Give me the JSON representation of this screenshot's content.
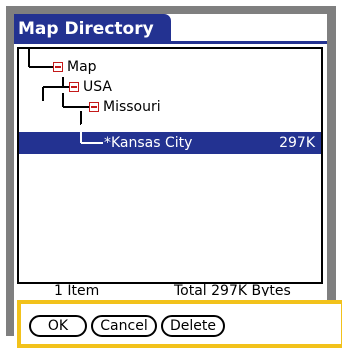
{
  "window": {
    "title": "Map Directory"
  },
  "tree": {
    "nodes": [
      {
        "label": "Map"
      },
      {
        "label": "USA"
      },
      {
        "label": "Missouri"
      }
    ],
    "selected": {
      "label": "*Kansas City",
      "size": "297K"
    }
  },
  "status": {
    "items_text": "1 Item",
    "total_text": "Total 297K Bytes"
  },
  "buttons": {
    "ok": "OK",
    "cancel": "Cancel",
    "delete": "Delete"
  },
  "colors": {
    "title_bg": "#233291",
    "selection_bg": "#233291",
    "expander": "#c41a1a",
    "highlight": "#f2c21b",
    "frame": "#7f7f7f"
  },
  "icons": {
    "expander": "minus-box-icon"
  }
}
